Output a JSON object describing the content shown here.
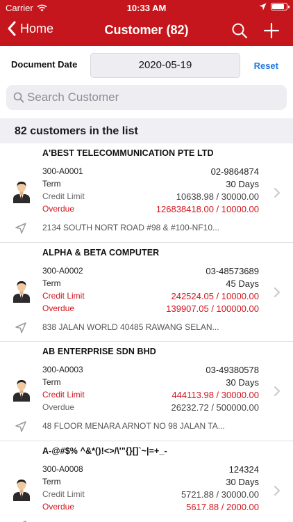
{
  "status_bar": {
    "carrier": "Carrier",
    "time": "10:33 AM"
  },
  "nav": {
    "back_label": "Home",
    "title": "Customer (82)"
  },
  "doc_date": {
    "label": "Document Date",
    "value": "2020-05-19",
    "reset_label": "Reset"
  },
  "search": {
    "placeholder": "Search Customer"
  },
  "list_count": "82 customers in the list",
  "colors": {
    "brand": "#c4161c",
    "link": "#1f7ae0",
    "alert": "#d0161e"
  },
  "customers": [
    {
      "name": "A'BEST TELECOMMUNICATION PTE LTD",
      "code": "300-A0001",
      "phone": "02-9864874",
      "term_label": "Term",
      "term": "30 Days",
      "credit_label": "Credit Limit",
      "credit": "10638.98 / 30000.00",
      "credit_alert": false,
      "overdue_label": "Overdue",
      "overdue": "126838418.00 / 10000.00",
      "overdue_alert": true,
      "address": "2134 SOUTH NORT ROAD  #98 & #100-NF10..."
    },
    {
      "name": "ALPHA & BETA COMPUTER",
      "code": "300-A0002",
      "phone": "03-48573689",
      "term_label": "Term",
      "term": "45 Days",
      "credit_label": "Credit Limit",
      "credit": "242524.05 / 10000.00",
      "credit_alert": true,
      "overdue_label": "Overdue",
      "overdue": "139907.05 / 100000.00",
      "overdue_alert": true,
      "address": "838 JALAN WORLD  40485 RAWANG  SELAN..."
    },
    {
      "name": "AB ENTERPRISE SDN BHD",
      "code": "300-A0003",
      "phone": "03-49380578",
      "term_label": "Term",
      "term": "30 Days",
      "credit_label": "Credit Limit",
      "credit": "444113.98 / 30000.00",
      "credit_alert": true,
      "overdue_label": "Overdue",
      "overdue": "26232.72 / 500000.00",
      "overdue_alert": false,
      "address": "48 FLOOR MENARA ARNOT  NO 98 JALAN TA..."
    },
    {
      "name": "A-@#$% ^&*()!<>/\\'\"{}[]`~|=+_-",
      "code": "300-A0008",
      "phone": "124324",
      "term_label": "Term",
      "term": "30 Days",
      "credit_label": "Credit Limit",
      "credit": "5721.88 / 30000.00",
      "credit_alert": false,
      "overdue_label": "Overdue",
      "overdue": "5617.88 / 2000.00",
      "overdue_alert": true,
      "address": ""
    }
  ]
}
